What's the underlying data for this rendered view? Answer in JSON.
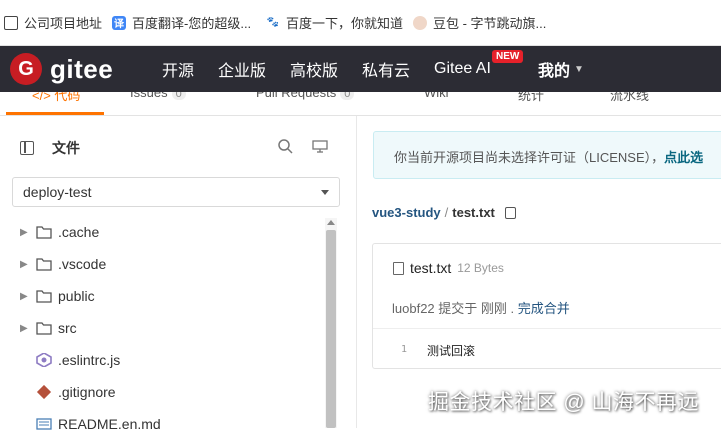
{
  "bookmarks": [
    {
      "label": "公司项目地址",
      "icon": "folder-icon"
    },
    {
      "label": "百度翻译-您的超级...",
      "icon": "fanyi-icon"
    },
    {
      "label": "百度一下，你就知道",
      "icon": "baidu-icon"
    },
    {
      "label": "豆包 - 字节跳动旗...",
      "icon": "doubao-icon"
    }
  ],
  "header": {
    "logo_mark": "G",
    "logo_text": "gitee",
    "nav": [
      "开源",
      "企业版",
      "高校版",
      "私有云",
      "Gitee AI",
      "我的"
    ],
    "new_badge": "NEW",
    "bg_color": "#2c2c34",
    "brand_color": "#c71d23"
  },
  "tabs": {
    "code": "代码",
    "issues": "Issues",
    "issues_count": "0",
    "pr": "Pull Requests",
    "pr_count": "0",
    "wiki": "Wiki",
    "stats": "统计",
    "pipeline": "流水线",
    "accent_color": "#fe7300"
  },
  "sidebar": {
    "title": "文件",
    "branch": "deploy-test",
    "items": [
      {
        "name": ".cache",
        "type": "folder"
      },
      {
        "name": ".vscode",
        "type": "folder"
      },
      {
        "name": "public",
        "type": "folder"
      },
      {
        "name": "src",
        "type": "folder"
      },
      {
        "name": ".eslintrc.js",
        "type": "eslint-file"
      },
      {
        "name": ".gitignore",
        "type": "git-file"
      },
      {
        "name": "README.en.md",
        "type": "markdown-file"
      }
    ]
  },
  "main": {
    "license_notice": "你当前开源项目尚未选择许可证（LICENSE），",
    "license_link": "点此选",
    "breadcrumb_repo": "vue3-study",
    "breadcrumb_sep": "/",
    "breadcrumb_file": "test.txt",
    "file_name": "test.txt",
    "file_size": "12 Bytes",
    "commit_author": "luobf22 提交于 刚刚 . ",
    "commit_message": "完成合并",
    "line_number": "1",
    "line_text": "测试回滚"
  },
  "watermark": "掘金技术社区 @ 山海不再远"
}
